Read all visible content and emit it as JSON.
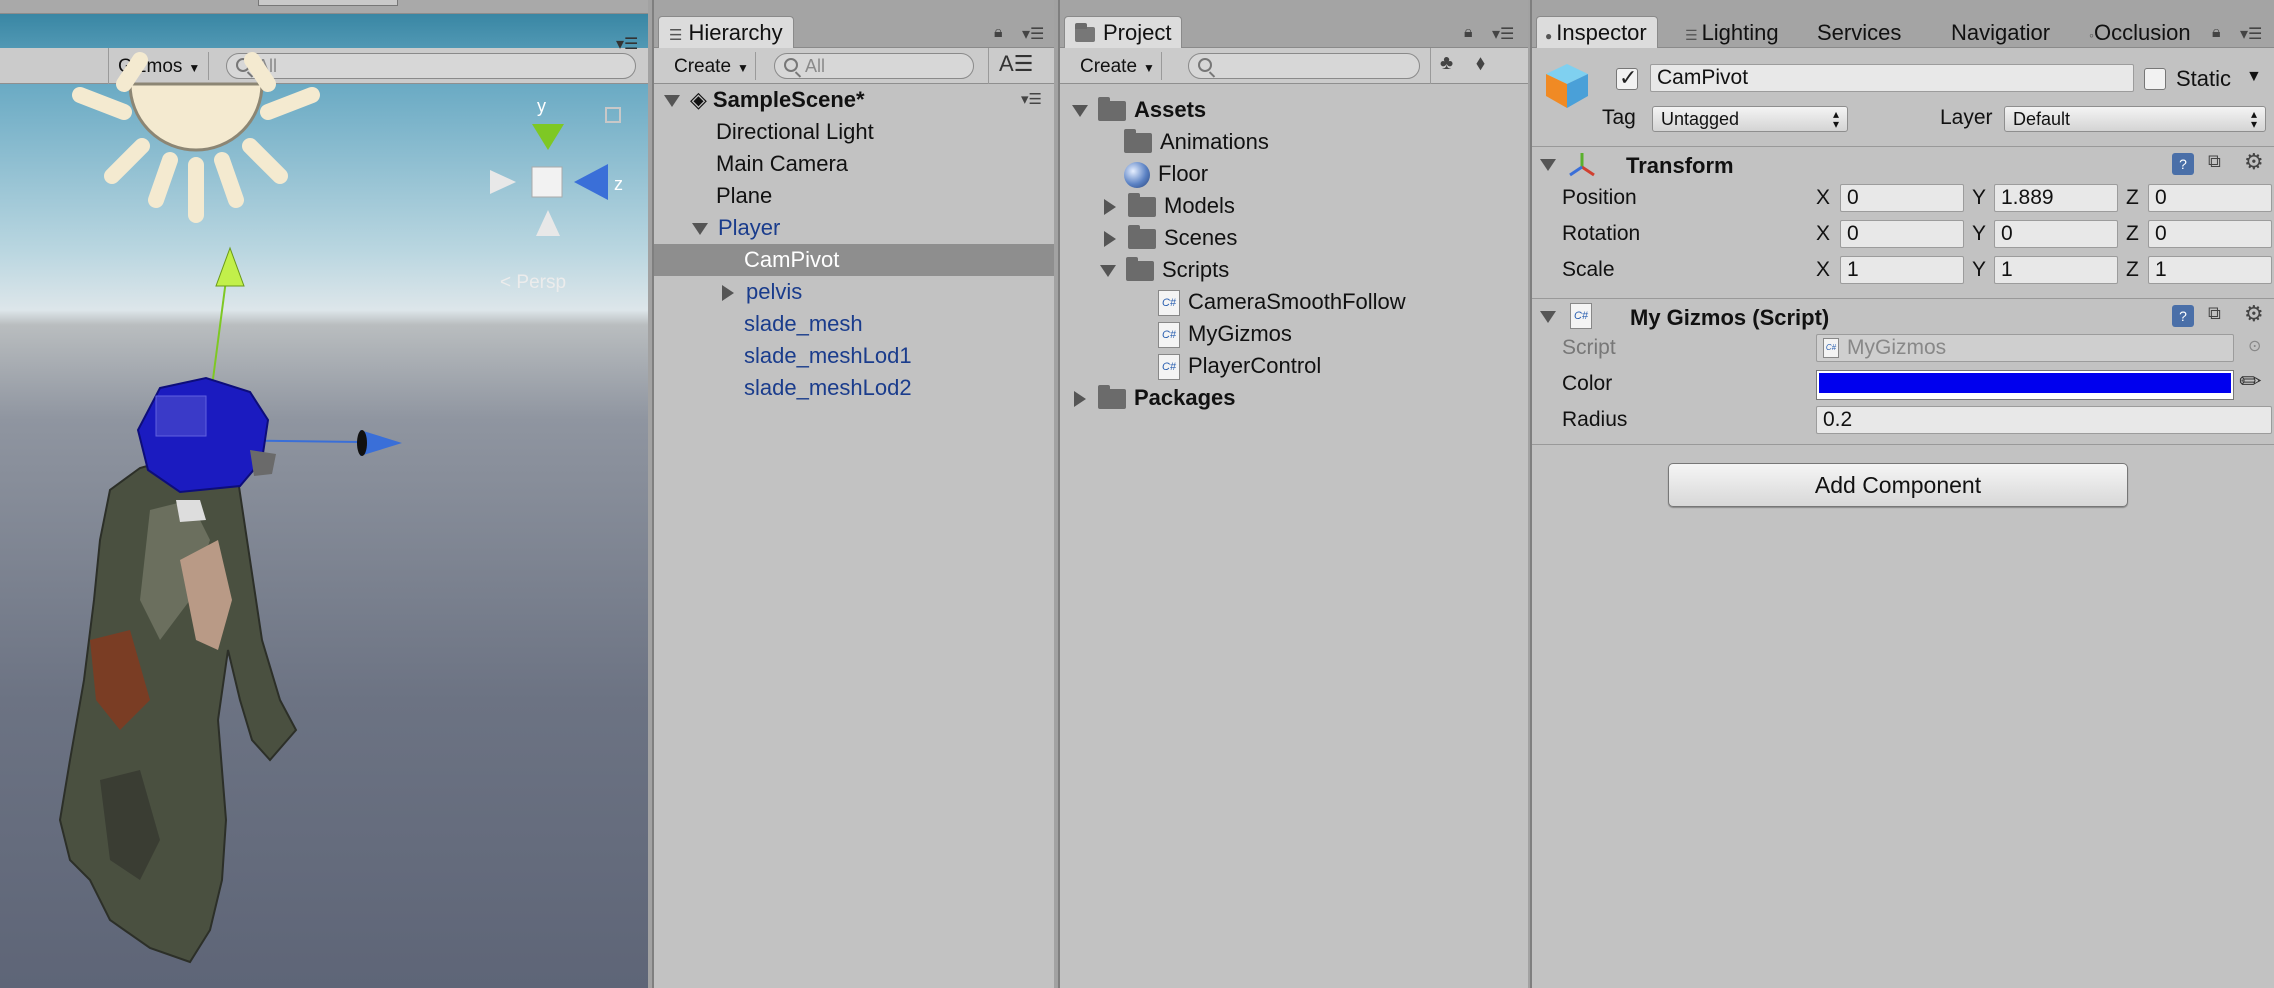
{
  "scene": {
    "gizmos_label": "Gizmos",
    "search_placeholder": "All",
    "axis_y": "y",
    "axis_z": "z",
    "persp_label": "Persp"
  },
  "hierarchy": {
    "tab_label": "Hierarchy",
    "create_label": "Create",
    "search_placeholder": "All",
    "scene_name": "SampleScene*",
    "items": [
      {
        "label": "Directional Light"
      },
      {
        "label": "Main Camera"
      },
      {
        "label": "Plane"
      },
      {
        "label": "Player"
      },
      {
        "label": "CamPivot"
      },
      {
        "label": "pelvis"
      },
      {
        "label": "slade_mesh"
      },
      {
        "label": "slade_meshLod1"
      },
      {
        "label": "slade_meshLod2"
      }
    ]
  },
  "project": {
    "tab_label": "Project",
    "create_label": "Create",
    "items": [
      {
        "label": "Assets"
      },
      {
        "label": "Animations"
      },
      {
        "label": "Floor"
      },
      {
        "label": "Models"
      },
      {
        "label": "Scenes"
      },
      {
        "label": "Scripts"
      },
      {
        "label": "CameraSmoothFollow"
      },
      {
        "label": "MyGizmos"
      },
      {
        "label": "PlayerControl"
      },
      {
        "label": "Packages"
      }
    ]
  },
  "inspector": {
    "tabs": [
      {
        "label": "Inspector"
      },
      {
        "label": "Lighting"
      },
      {
        "label": "Services"
      },
      {
        "label": "Navigatior"
      },
      {
        "label": "Occlusion"
      }
    ],
    "object_name": "CamPivot",
    "static_label": "Static",
    "tag_label": "Tag",
    "tag_value": "Untagged",
    "layer_label": "Layer",
    "layer_value": "Default",
    "transform": {
      "title": "Transform",
      "position_label": "Position",
      "rotation_label": "Rotation",
      "scale_label": "Scale",
      "x_label": "X",
      "y_label": "Y",
      "z_label": "Z",
      "position": {
        "x": "0",
        "y": "1.889",
        "z": "0"
      },
      "rotation": {
        "x": "0",
        "y": "0",
        "z": "0"
      },
      "scale": {
        "x": "1",
        "y": "1",
        "z": "1"
      }
    },
    "script_component": {
      "title": "My Gizmos (Script)",
      "script_label": "Script",
      "script_value": "MyGizmos",
      "color_label": "Color",
      "color_value": "#0000ee",
      "radius_label": "Radius",
      "radius_value": "0.2"
    },
    "add_component_label": "Add Component"
  }
}
